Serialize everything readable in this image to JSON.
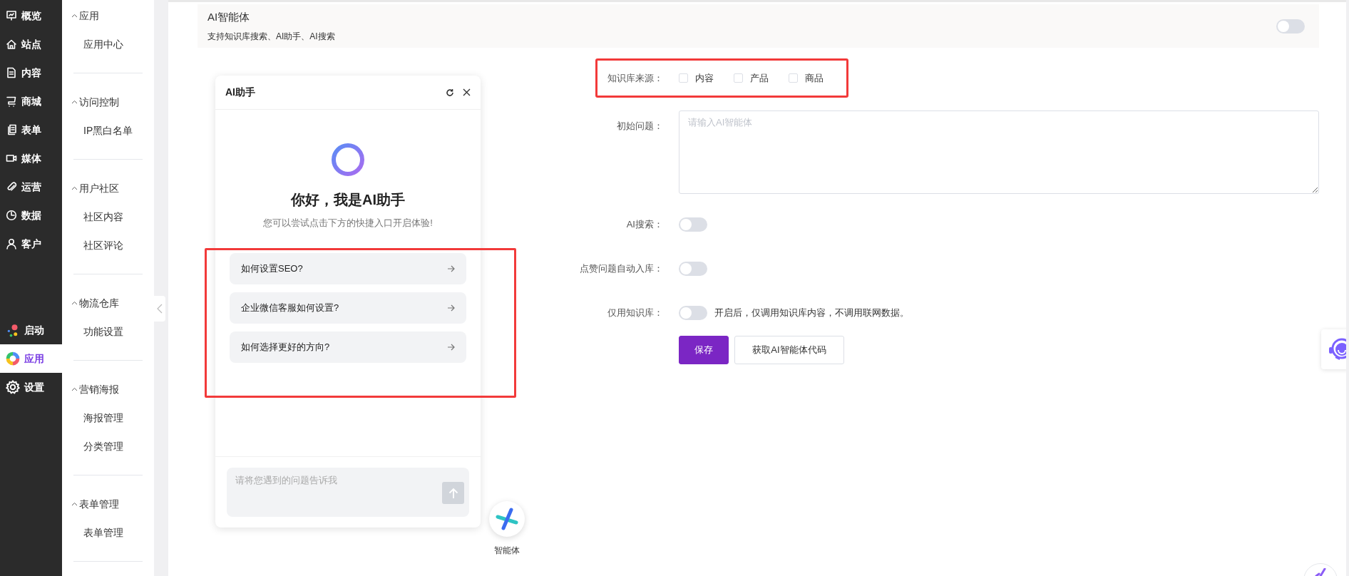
{
  "nav": {
    "top": [
      {
        "label": "概览",
        "selected": false
      },
      {
        "label": "站点",
        "selected": false
      },
      {
        "label": "内容",
        "selected": false
      },
      {
        "label": "商城",
        "selected": false
      },
      {
        "label": "表单",
        "selected": false
      },
      {
        "label": "媒体",
        "selected": false
      },
      {
        "label": "运营",
        "selected": false
      },
      {
        "label": "数据",
        "selected": false
      },
      {
        "label": "客户",
        "selected": false
      }
    ],
    "bottom": [
      {
        "label": "启动",
        "selected": false
      },
      {
        "label": "应用",
        "selected": true
      },
      {
        "label": "设置",
        "selected": false
      }
    ]
  },
  "sidebar": {
    "groups": [
      {
        "title": "应用",
        "expanded": true,
        "items": [
          "应用中心"
        ]
      },
      {
        "title": "访问控制",
        "expanded": true,
        "items": [
          "IP黑白名单"
        ]
      },
      {
        "title": "用户社区",
        "expanded": true,
        "items": [
          "社区内容",
          "社区评论"
        ]
      },
      {
        "title": "物流仓库",
        "expanded": true,
        "items": [
          "功能设置"
        ]
      },
      {
        "title": "营销海报",
        "expanded": true,
        "items": [
          "海报管理",
          "分类管理"
        ]
      },
      {
        "title": "表单管理",
        "expanded": true,
        "items": [
          "表单管理"
        ]
      }
    ]
  },
  "header": {
    "title": "AI智能体",
    "subtitle": "支持知识库搜索、AI助手、AI搜索",
    "on": false
  },
  "assistant": {
    "title": "AI助手",
    "greeting": "你好，我是AI助手",
    "hint": "您可以尝试点击下方的快捷入口开启体验!",
    "suggestions": [
      "如何设置SEO?",
      "企业微信客服如何设置?",
      "如何选择更好的方向?"
    ],
    "input": {
      "placeholder": "请将您遇到的问题告诉我"
    }
  },
  "floating_button": {
    "label": "智能体"
  },
  "form": {
    "knowledge_source": {
      "label": "知识库来源：",
      "options": [
        {
          "label": "内容",
          "checked": false
        },
        {
          "label": "产品",
          "checked": false
        },
        {
          "label": "商品",
          "checked": false
        }
      ]
    },
    "initial_question": {
      "label": "初始问题：",
      "placeholder": "请输入AI智能体"
    },
    "switches": [
      {
        "label": "AI搜索：",
        "on": false
      },
      {
        "label": "点赞问题自动入库：",
        "on": false
      },
      {
        "label": "仅用知识库：",
        "on": false,
        "note": "开启后，仅调用知识库内容，不调用联网数据。"
      }
    ],
    "buttons": [
      {
        "label": "保存",
        "kind": "primary"
      },
      {
        "label": "获取AI智能体代码",
        "kind": "secondary"
      }
    ]
  }
}
